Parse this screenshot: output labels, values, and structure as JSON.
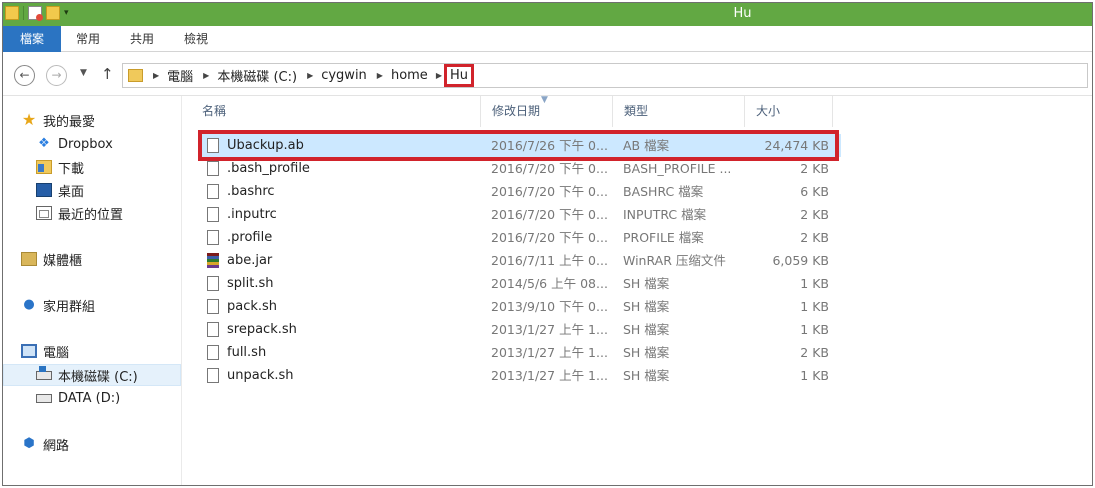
{
  "window": {
    "title": "Hu",
    "quick_access_dropdown": "▾"
  },
  "ribbon": {
    "tabs": [
      "檔案",
      "常用",
      "共用",
      "檢視"
    ]
  },
  "address_bar": {
    "breadcrumbs": [
      "電腦",
      "本機磁碟 (C:)",
      "cygwin",
      "home",
      "Hu"
    ],
    "highlighted_crumb": "Hu"
  },
  "nav_pane": {
    "favorites": "我的最愛",
    "dropbox": "Dropbox",
    "downloads": "下載",
    "desktop": "桌面",
    "recent": "最近的位置",
    "libraries": "媒體櫃",
    "homegroup": "家用群組",
    "computer": "電腦",
    "drive_c": "本機磁碟 (C:)",
    "drive_d": "DATA (D:)",
    "network": "網路"
  },
  "columns": {
    "name": "名稱",
    "date": "修改日期",
    "type": "類型",
    "size": "大小"
  },
  "files": [
    {
      "name": "Ubackup.ab",
      "date": "2016/7/26 下午 0...",
      "type": "AB 檔案",
      "size": "24,474 KB",
      "icon": "file-icon",
      "selected": true
    },
    {
      "name": ".bash_profile",
      "date": "2016/7/20 下午 0...",
      "type": "BASH_PROFILE ...",
      "size": "2 KB",
      "icon": "file-icon"
    },
    {
      "name": ".bashrc",
      "date": "2016/7/20 下午 0...",
      "type": "BASHRC 檔案",
      "size": "6 KB",
      "icon": "file-icon"
    },
    {
      "name": ".inputrc",
      "date": "2016/7/20 下午 0...",
      "type": "INPUTRC 檔案",
      "size": "2 KB",
      "icon": "file-icon"
    },
    {
      "name": ".profile",
      "date": "2016/7/20 下午 0...",
      "type": "PROFILE 檔案",
      "size": "2 KB",
      "icon": "file-icon"
    },
    {
      "name": "abe.jar",
      "date": "2016/7/11 上午 0...",
      "type": "WinRAR 压缩文件",
      "size": "6,059 KB",
      "icon": "winrar-archive-icon"
    },
    {
      "name": "split.sh",
      "date": "2014/5/6 上午 08...",
      "type": "SH 檔案",
      "size": "1 KB",
      "icon": "file-icon"
    },
    {
      "name": "pack.sh",
      "date": "2013/9/10 下午 0...",
      "type": "SH 檔案",
      "size": "1 KB",
      "icon": "file-icon"
    },
    {
      "name": "srepack.sh",
      "date": "2013/1/27 上午 1...",
      "type": "SH 檔案",
      "size": "1 KB",
      "icon": "file-icon"
    },
    {
      "name": "full.sh",
      "date": "2013/1/27 上午 1...",
      "type": "SH 檔案",
      "size": "2 KB",
      "icon": "file-icon"
    },
    {
      "name": "unpack.sh",
      "date": "2013/1/27 上午 1...",
      "type": "SH 檔案",
      "size": "1 KB",
      "icon": "file-icon"
    }
  ],
  "colors": {
    "titlebar": "#62a843",
    "active_tab": "#2b74c2",
    "selection": "#cce8ff",
    "annotation": "#d1232b"
  }
}
